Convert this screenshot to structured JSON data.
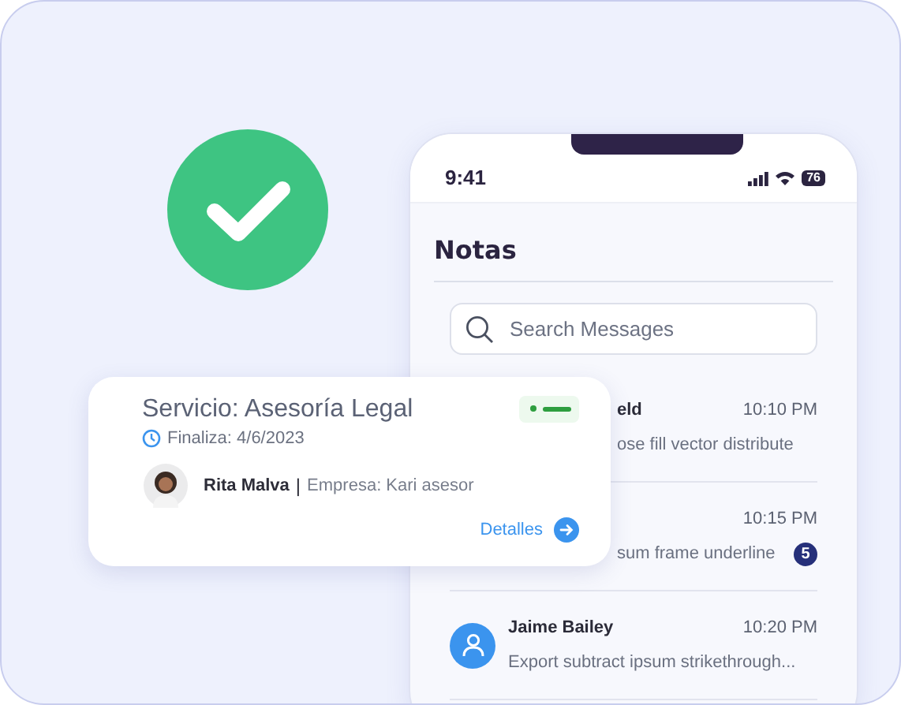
{
  "phone": {
    "time": "9:41",
    "battery": "76",
    "title": "Notas",
    "search": {
      "placeholder": "Search Messages"
    },
    "messages": [
      {
        "kind": "partial",
        "name": "eld",
        "time": "10:10 PM",
        "text": "ose fill vector distribute"
      },
      {
        "kind": "partial",
        "time": "10:15 PM",
        "text": "sum frame underline",
        "badge": "5"
      },
      {
        "kind": "full",
        "name": "Jaime Bailey",
        "time": "10:20 PM",
        "text": "Export subtract ipsum strikethrough..."
      }
    ]
  },
  "card": {
    "title": "Servicio: Asesoría Legal",
    "ends": "Finaliza: 4/6/2023",
    "person": "Rita Malva",
    "separator": "|",
    "company": "Empresa: Kari asesor",
    "link": "Detalles"
  }
}
